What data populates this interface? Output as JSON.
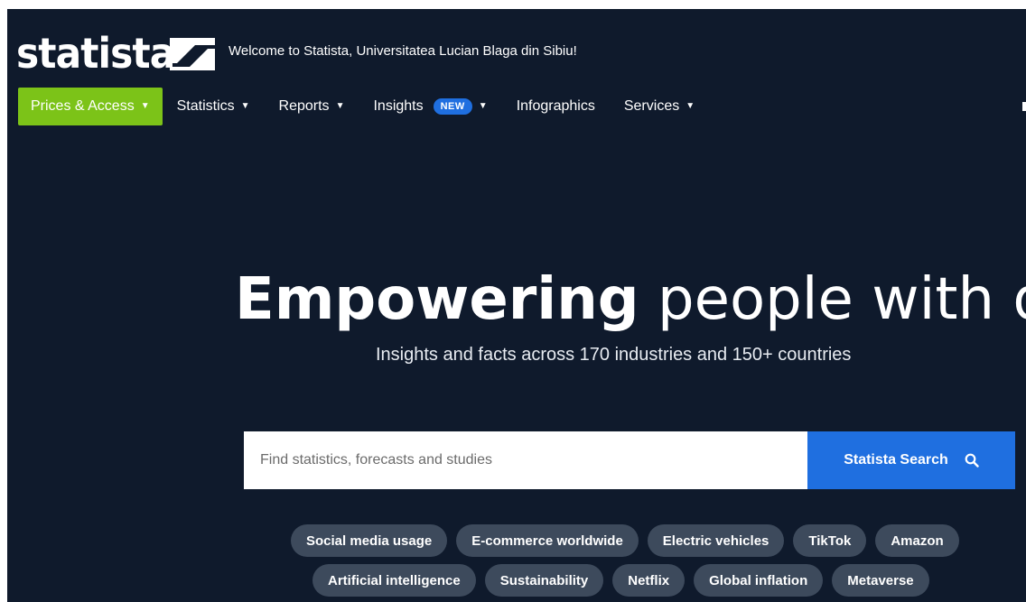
{
  "header": {
    "logo_text": "statista",
    "welcome": "Welcome to Statista, Universitatea Lucian Blaga din Sibiu!"
  },
  "nav": {
    "items": [
      {
        "label": "Prices & Access",
        "dropdown": true
      },
      {
        "label": "Statistics",
        "dropdown": true
      },
      {
        "label": "Reports",
        "dropdown": true
      },
      {
        "label": "Insights",
        "dropdown": true,
        "badge": "NEW"
      },
      {
        "label": "Infographics",
        "dropdown": false
      },
      {
        "label": "Services",
        "dropdown": true
      }
    ]
  },
  "hero": {
    "title_bold": "Empowering",
    "title_light": "people with data",
    "subtitle": "Insights and facts across 170 industries and 150+ countries"
  },
  "search": {
    "placeholder": "Find statistics, forecasts and studies",
    "button_label": "Statista Search"
  },
  "chips": {
    "row1": [
      "Social media usage",
      "E-commerce worldwide",
      "Electric vehicles",
      "TikTok",
      "Amazon"
    ],
    "row2": [
      "Artificial intelligence",
      "Sustainability",
      "Netflix",
      "Global inflation",
      "Metaverse"
    ]
  },
  "colors": {
    "background": "#0f1a2c",
    "accent_green": "#7cc318",
    "accent_blue": "#1f6fe0",
    "chip": "#3d4a5c"
  }
}
